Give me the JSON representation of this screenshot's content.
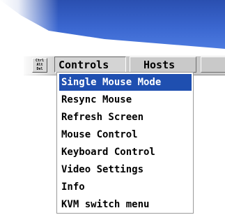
{
  "window": {
    "title_bar_color": "#3a66cf"
  },
  "menubar": {
    "cad_button_lines": [
      "Ctrl",
      "Alt",
      "Del"
    ],
    "tabs": [
      {
        "label": "Controls",
        "active": true
      },
      {
        "label": "Hosts",
        "active": false
      },
      {
        "label": "",
        "active": false
      }
    ]
  },
  "dropdown": {
    "selected_color": "#1f4fb0",
    "items": [
      {
        "label": "Single Mouse Mode",
        "selected": true
      },
      {
        "label": "Resync Mouse",
        "selected": false
      },
      {
        "label": "Refresh Screen",
        "selected": false
      },
      {
        "label": "Mouse Control",
        "selected": false
      },
      {
        "label": "Keyboard Control",
        "selected": false
      },
      {
        "label": "Video Settings",
        "selected": false
      },
      {
        "label": "Info",
        "selected": false
      },
      {
        "label": "KVM switch menu",
        "selected": false
      }
    ]
  }
}
